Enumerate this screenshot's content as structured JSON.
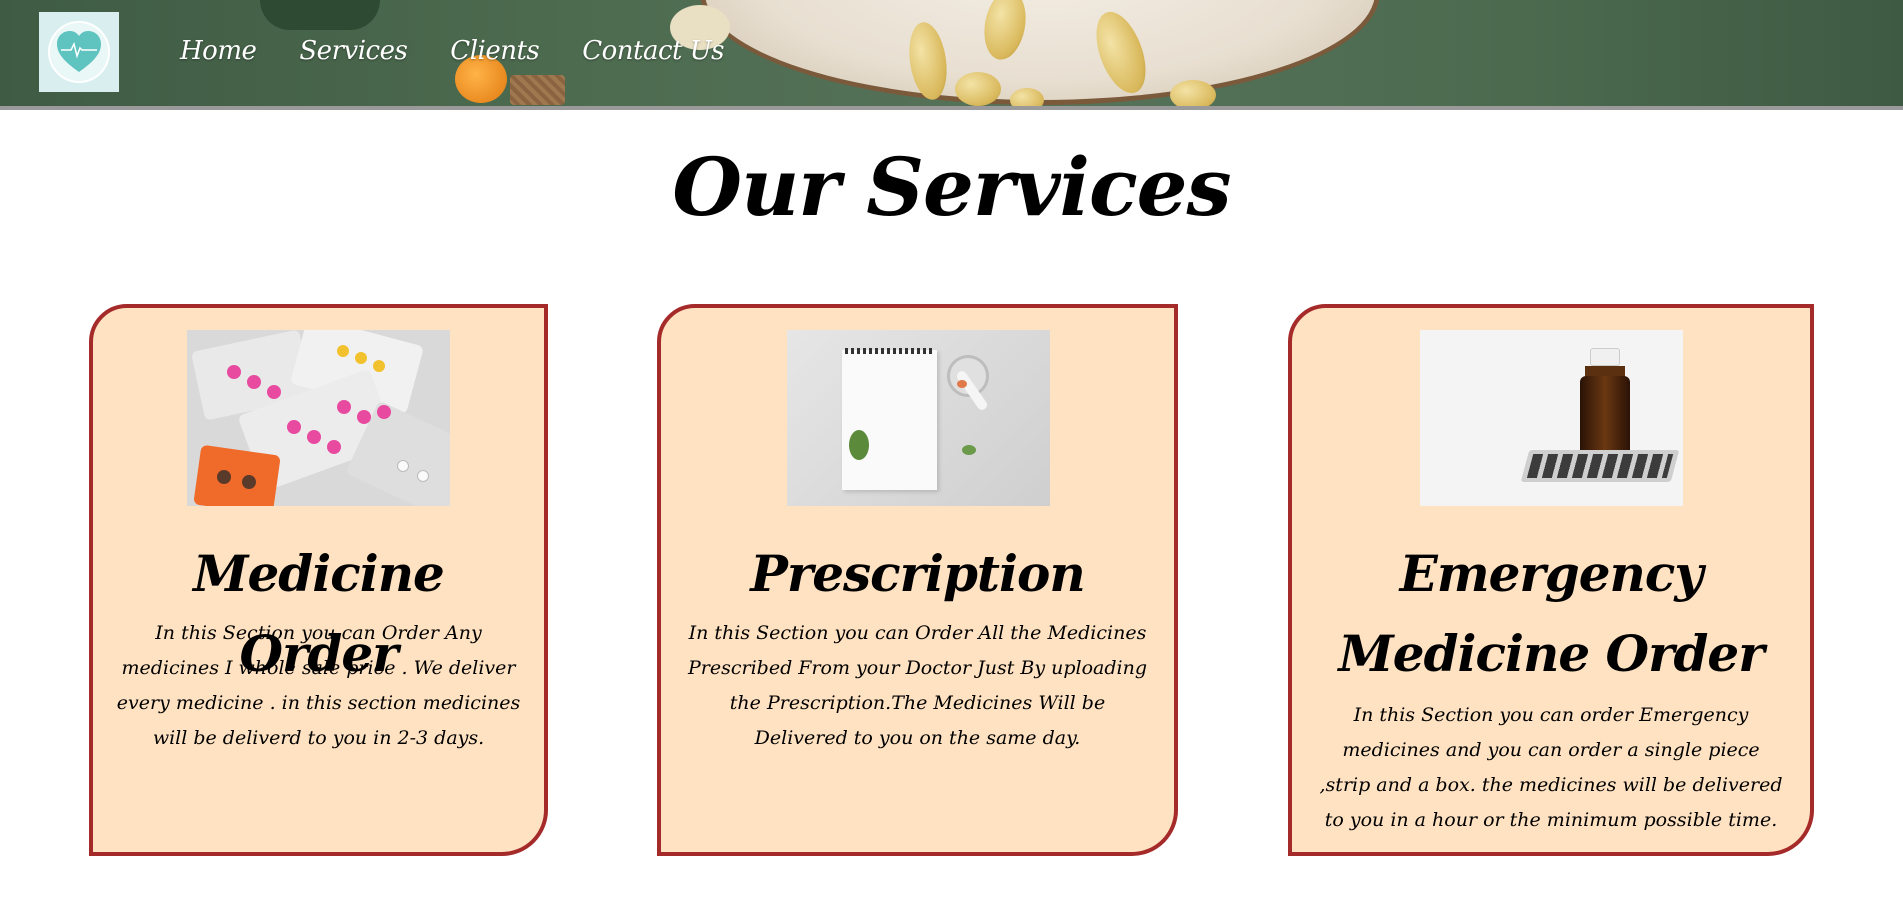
{
  "nav": {
    "items": [
      {
        "label": "Home"
      },
      {
        "label": "Services"
      },
      {
        "label": "Clients"
      },
      {
        "label": "Contact Us"
      }
    ]
  },
  "main": {
    "title": "Our Services",
    "cards": [
      {
        "title": "Medicine Order",
        "text": "In this Section you can Order Any medicines I whole sale price . We deliver every medicine . in this section medicines will be deliverd to you in 2-3 days."
      },
      {
        "title": "Prescription",
        "text": "In this Section you can Order All the Medicines Prescribed From your Doctor Just By uploading the Prescription.The Medicines Will be Delivered to you on the same day."
      },
      {
        "title": "Emergency Medicine Order",
        "text": "In this Section you can order Emergency medicines and you can order a single piece ,strip and a box. the medicines will be delivered to you in a hour or the minimum possible time."
      }
    ]
  },
  "colors": {
    "card_background": "#ffe2c2",
    "card_border": "#a52a2a",
    "header_green": "#4d6b4f"
  },
  "icons": {
    "logo": "heart-pulse-icon"
  }
}
